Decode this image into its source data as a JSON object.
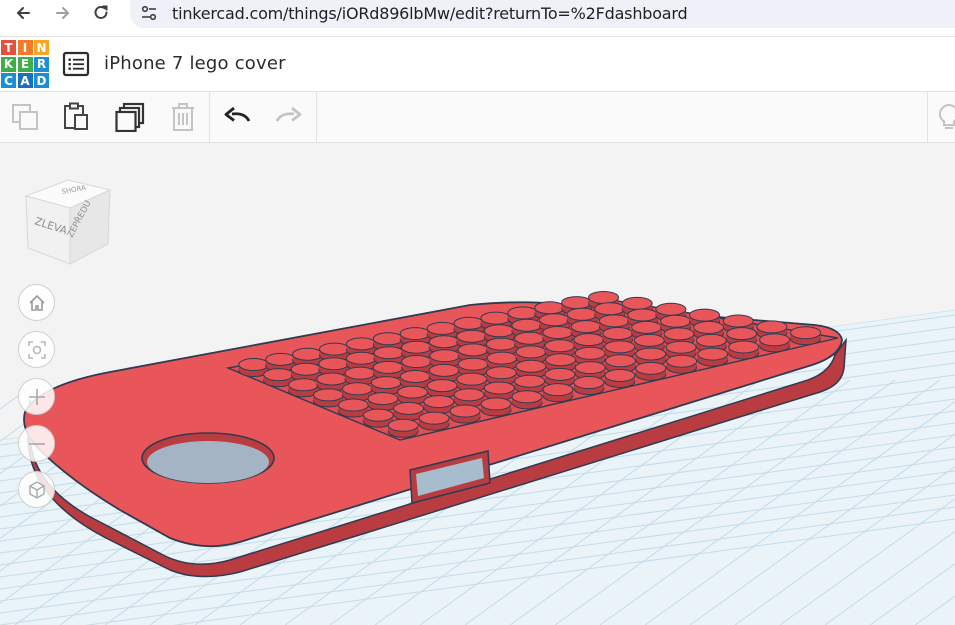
{
  "browser": {
    "url": "tinkercad.com/things/iORd896lbMw/edit?returnTo=%2Fdashboard"
  },
  "logo": {
    "letters": [
      "T",
      "I",
      "N",
      "K",
      "E",
      "R",
      "C",
      "A",
      "D"
    ],
    "colors": [
      "#e94e3c",
      "#f37a2a",
      "#f6a623",
      "#3fae49",
      "#3fae49",
      "#1a8fd6",
      "#1a8fd6",
      "#1a6fc0",
      "#1a8fd6"
    ]
  },
  "header": {
    "title": "iPhone 7 lego cover"
  },
  "toolbar": {
    "buttons": [
      "copy-icon",
      "paste-icon",
      "duplicate-icon",
      "delete-icon",
      "undo-icon",
      "redo-icon",
      "lightbulb-icon"
    ]
  },
  "viewcube": {
    "top_label": "SHORA",
    "left_label": "ZLEVA",
    "right_label": "ZEPŘEDU"
  },
  "view_controls": [
    "home-view-icon",
    "fit-view-icon",
    "zoom-in-icon",
    "zoom-out-icon",
    "ortho-view-icon"
  ],
  "colors": {
    "shape_fill": "#e8565a",
    "shape_outline": "#2f3b52",
    "grid_line": "#bcd9e8",
    "workplane_bg": "#f3f3f3"
  }
}
